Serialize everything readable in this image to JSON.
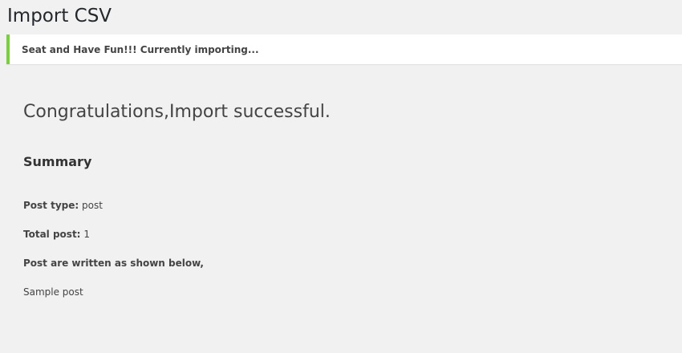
{
  "page": {
    "title": "Import CSV"
  },
  "notice": {
    "text": "Seat and Have Fun!!! Currently importing...",
    "accent_color": "#7ad03a"
  },
  "result": {
    "heading": "Congratulations,Import successful."
  },
  "summary": {
    "heading": "Summary",
    "post_type_label": "Post type:",
    "post_type_value": "post",
    "total_label": "Total post:",
    "total_value": "1",
    "written_label": "Post are written as shown below,",
    "posts": [
      "Sample post"
    ]
  }
}
